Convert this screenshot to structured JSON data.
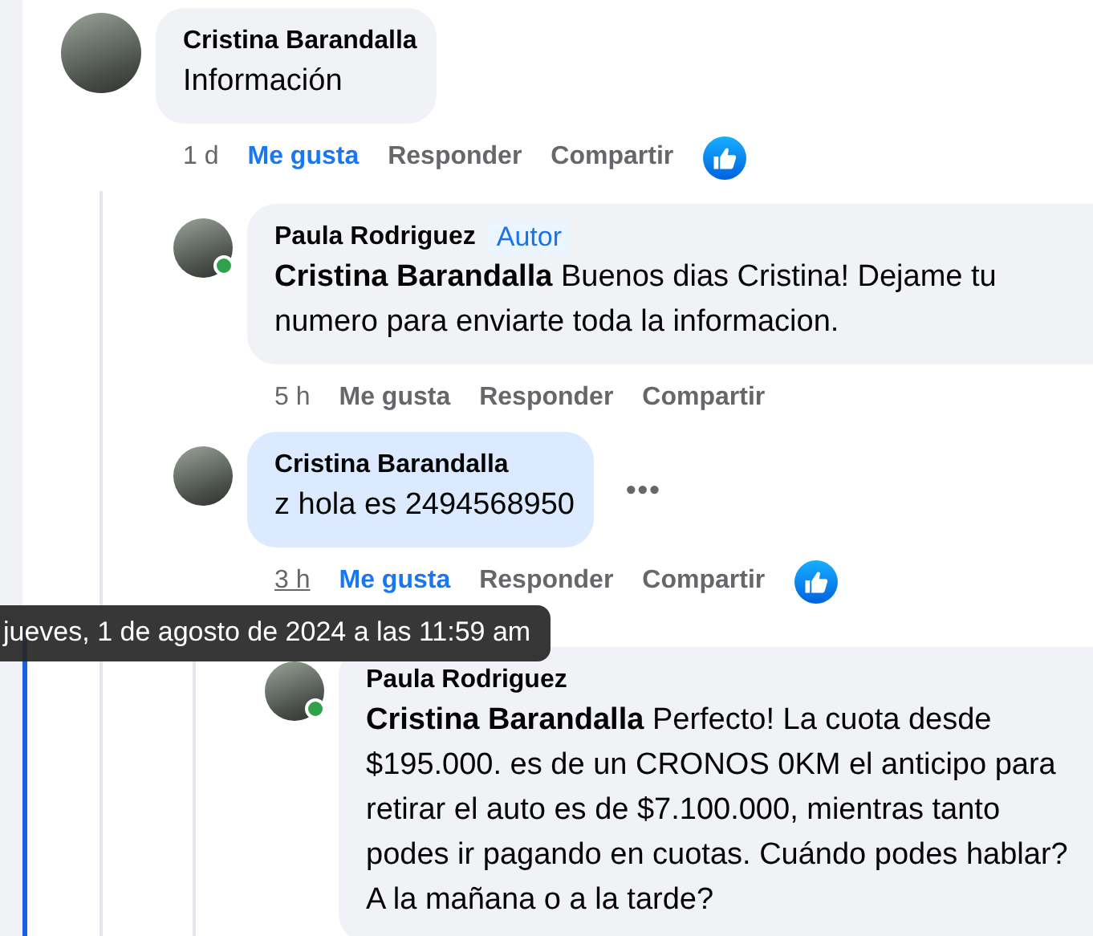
{
  "comments": [
    {
      "author": "Cristina Barandalla",
      "text": "Información",
      "time": "1 d",
      "time_hovered": false,
      "liked": true,
      "reaction": true,
      "actions": [
        "Me gusta",
        "Responder",
        "Compartir"
      ],
      "children": [
        {
          "author": "Paula Rodriguez",
          "badge": "Autor",
          "text": "**Cristina Barandalla** Buenos dias Cristina! Dejame tu numero para enviarte toda la informacion.",
          "time": "5 h",
          "time_hovered": false,
          "liked": false,
          "online": true,
          "actions": [
            "Me gusta",
            "Responder",
            "Compartir"
          ]
        },
        {
          "author": "Cristina Barandalla",
          "text": "z hola es 2494568950",
          "time": "3 h",
          "time_hovered": true,
          "liked": true,
          "reaction": true,
          "highlighted": true,
          "more_menu": "•••",
          "actions": [
            "Me gusta",
            "Responder",
            "Compartir"
          ],
          "children": [
            {
              "author": "Paula Rodriguez",
              "text": "**Cristina Barandalla** Perfecto! La cuota desde $195.000. es de un CRONOS 0KM el anticipo para retirar el auto es de $7.100.000, mientras tanto podes ir pagando en cuotas. Cuándo podes hablar? A la mañana o a la tarde?",
              "online": true
            }
          ]
        }
      ]
    }
  ],
  "tooltip": {
    "text": "jueves, 1 de agosto de 2024 a las 11:59 am"
  }
}
